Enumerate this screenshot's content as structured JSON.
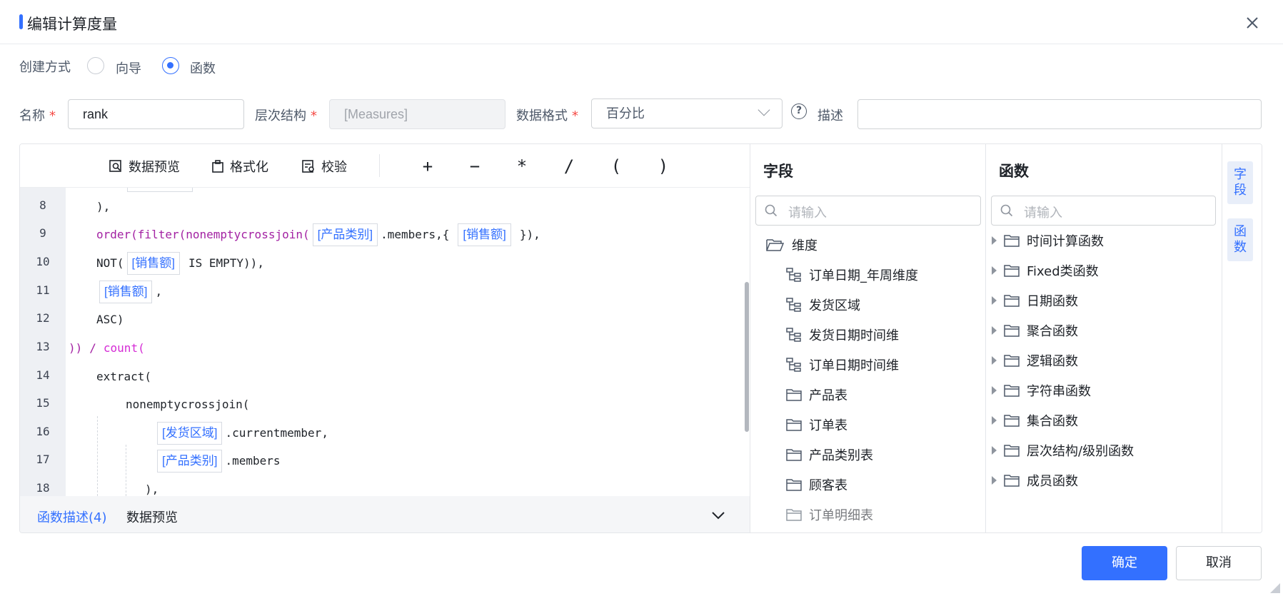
{
  "dialog": {
    "title": "编辑计算度量"
  },
  "creation": {
    "label": "创建方式",
    "options": [
      {
        "label": "向导",
        "selected": false
      },
      {
        "label": "函数",
        "selected": true
      }
    ]
  },
  "form": {
    "name_label": "名称",
    "name_value": "rank",
    "hierarchy_label": "层次结构",
    "hierarchy_value": "[Measures]",
    "format_label": "数据格式",
    "format_value": "百分比",
    "desc_label": "描述",
    "desc_value": "",
    "required_mark": "*"
  },
  "toolbar": {
    "preview": "数据预览",
    "format": "格式化",
    "validate": "校验",
    "ops": [
      "+",
      "−",
      "*",
      "/",
      "(",
      ")"
    ]
  },
  "editor": {
    "line_numbers": [
      "8",
      "9",
      "10",
      "11",
      "12",
      "13",
      "14",
      "15",
      "16",
      "17",
      "18"
    ],
    "tokens": {
      "l8": "),",
      "l9_a": "order(filter(nonemptycrossjoin(",
      "l9_chip1": "[产品类别]",
      "l9_b": ".members,{",
      "l9_chip2": "[销售额]",
      "l9_c": "}),",
      "l10_a": "NOT(",
      "l10_chip": "[销售额]",
      "l10_b": "IS EMPTY)),",
      "l11_chip": "[销售额]",
      "l11_b": ",",
      "l12": "ASC)",
      "l13_a": "))",
      "l13_b": "/",
      "l13_c": "count(",
      "l14": "extract(",
      "l15": "nonemptycrossjoin(",
      "l16_chip": "[发货区域]",
      "l16_b": ".currentmember,",
      "l17_chip": "[产品类别]",
      "l17_b": ".members",
      "l18": "),"
    }
  },
  "footer_tabs": {
    "func_desc": "函数描述(4)",
    "data_preview": "数据预览"
  },
  "fields": {
    "title": "字段",
    "search_placeholder": "请输入",
    "root": "维度",
    "items": [
      "订单日期_年周维度",
      "发货区域",
      "发货日期时间维",
      "订单日期时间维",
      "产品表",
      "订单表",
      "产品类别表",
      "顾客表",
      "订单明细表"
    ]
  },
  "functions": {
    "title": "函数",
    "search_placeholder": "请输入",
    "items": [
      "时间计算函数",
      "Fixed类函数",
      "日期函数",
      "聚合函数",
      "逻辑函数",
      "字符串函数",
      "集合函数",
      "层次结构/级别函数",
      "成员函数"
    ]
  },
  "side_tabs": [
    "字段",
    "函数"
  ],
  "buttons": {
    "ok": "确定",
    "cancel": "取消"
  },
  "colors": {
    "accent": "#3370ff",
    "keyword": "#a322a3",
    "required": "#f54a45"
  }
}
